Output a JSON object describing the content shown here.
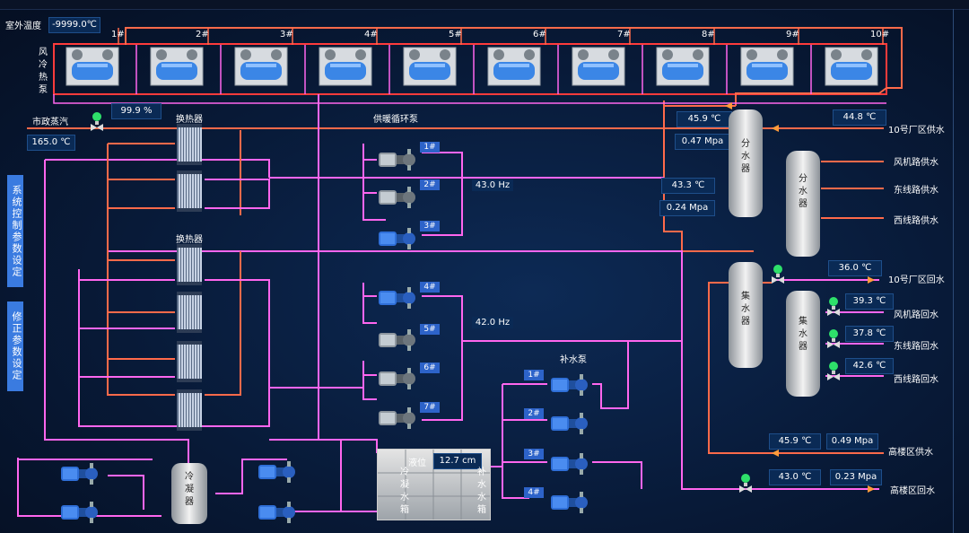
{
  "header": {
    "outdoor_temp_label": "室外温度",
    "outdoor_temp_value": "-9999.0℃"
  },
  "heat_pumps": {
    "group_label": "风冷热泵",
    "units": [
      "1#",
      "2#",
      "3#",
      "4#",
      "5#",
      "6#",
      "7#",
      "8#",
      "9#",
      "10#"
    ]
  },
  "steam": {
    "label": "市政蒸汽",
    "valve_pct": "99.9  %",
    "temp": "165.0 ℃"
  },
  "exchangers": {
    "group1_label": "换热器",
    "group2_label": "换热器"
  },
  "circ_pumps": {
    "title": "供暖循环泵",
    "upper": [
      "1#",
      "2#",
      "3#"
    ],
    "upper_freq": "43.0     Hz",
    "lower": [
      "4#",
      "5#",
      "6#",
      "7#"
    ],
    "lower_freq": "42.0     Hz"
  },
  "makeup_pumps": {
    "title": "补水泵",
    "units": [
      "1#",
      "2#",
      "3#",
      "4#"
    ]
  },
  "tank": {
    "level_label": "液位",
    "level_value": "12.7 cm",
    "cold_label": "冷凝水箱",
    "makeup_label": "补水水箱"
  },
  "condenser": {
    "label": "冷凝器"
  },
  "side_buttons": {
    "system_params": "系统控制参数设定",
    "correct_params": "修正参数设定"
  },
  "supply": {
    "header_temp": "45.9 ℃",
    "header_pressure": "0.47 Mpa",
    "mid_temp": "43.3 ℃",
    "mid_pressure": "0.24 Mpa",
    "dist1_label": "分水器",
    "dist2_label": "分水器",
    "factory10_temp": "44.8 ℃",
    "factory10_label": "10号厂区供水",
    "fan_road_label": "风机路供水",
    "east_line_label": "东线路供水",
    "west_line_label": "西线路供水"
  },
  "return": {
    "coll1_label": "集水器",
    "coll2_label": "集水器",
    "factory10_temp": "36.0 ℃",
    "factory10_label": "10号厂区回水",
    "fan_road_temp": "39.3 ℃",
    "fan_road_label": "风机路回水",
    "east_line_temp": "37.8 ℃",
    "east_line_label": "东线路回水",
    "west_line_temp": "42.6 ℃",
    "west_line_label": "西线路回水"
  },
  "high_building": {
    "supply_temp": "45.9 ℃",
    "supply_pressure": "0.49 Mpa",
    "supply_label": "高楼区供水",
    "return_temp": "43.0 ℃",
    "return_pressure": "0.23 Mpa",
    "return_label": "高楼区回水"
  },
  "colors": {
    "hot_pipe": "#ff6a4a",
    "cold_pipe": "#ff66ee",
    "value_box": "#0a2a55",
    "tag_blue": "#2d63c9",
    "pump_blue": "#2f6fd8",
    "valve_green": "#2ee06a"
  },
  "icons": [
    "heat-pump-icon",
    "heat-exchanger-icon",
    "pump-icon",
    "valve-icon",
    "tank-icon",
    "vessel-icon",
    "flow-arrow-icon"
  ]
}
